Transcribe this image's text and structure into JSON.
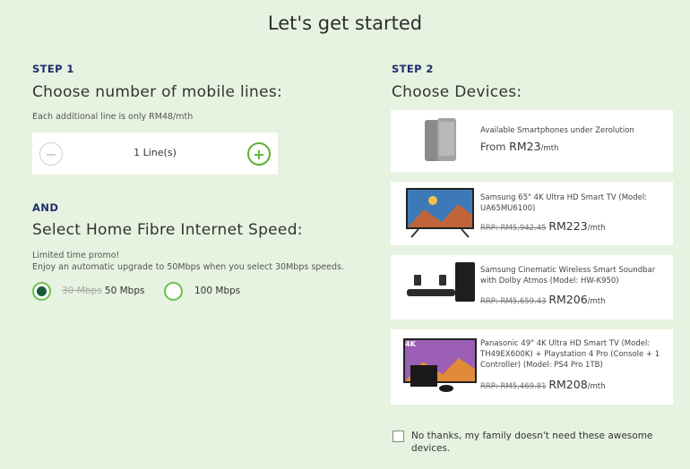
{
  "page": {
    "title": "Let's get started"
  },
  "step1": {
    "label": "STEP 1",
    "heading": "Choose number of mobile lines:",
    "note": "Each additional line is only RM48/mth",
    "lines_value": "1 Line(s)",
    "minus": "−",
    "plus": "+"
  },
  "fibre": {
    "and_label": "AND",
    "heading": "Select Home Fibre Internet Speed:",
    "promo_line1": "Limited time promo!",
    "promo_line2": "Enjoy an automatic upgrade to 50Mbps when you select 30Mbps speeds.",
    "options": [
      {
        "old": "30 Mbps",
        "label": "50 Mbps",
        "selected": true
      },
      {
        "label": "100 Mbps",
        "selected": false
      }
    ]
  },
  "step2": {
    "label": "STEP 2",
    "heading": "Choose Devices:",
    "devices": [
      {
        "name": "Available Smartphones under Zerolution",
        "price_prefix": "From ",
        "price": "RM23",
        "per": "/mth"
      },
      {
        "name": "Samsung 65\" 4K Ultra HD Smart TV (Model: UA65MU6100)",
        "rrp": "RRP: RM5,942.45",
        "price": "RM223",
        "per": "/mth"
      },
      {
        "name": "Samsung Cinematic Wireless Smart Soundbar with Dolby Atmos (Model: HW-K950)",
        "rrp": "RRP: RM5,659.43",
        "price": "RM206",
        "per": "/mth"
      },
      {
        "name": "Panasonic 49\" 4K Ultra HD Smart TV (Model: TH49EX600K) + Playstation 4 Pro (Console + 1 Controller) (Model: PS4 Pro 1TB)",
        "rrp": "RRP: RM5,469.81",
        "price": "RM208",
        "per": "/mth",
        "badge": "4K"
      }
    ],
    "no_thanks": "No thanks, my family doesn't need these awesome devices."
  },
  "colors": {
    "background": "#e6f3e0",
    "accent_green": "#5ab232",
    "step_blue": "#1f2b6e",
    "radio_selected": "#1a5c3a"
  }
}
